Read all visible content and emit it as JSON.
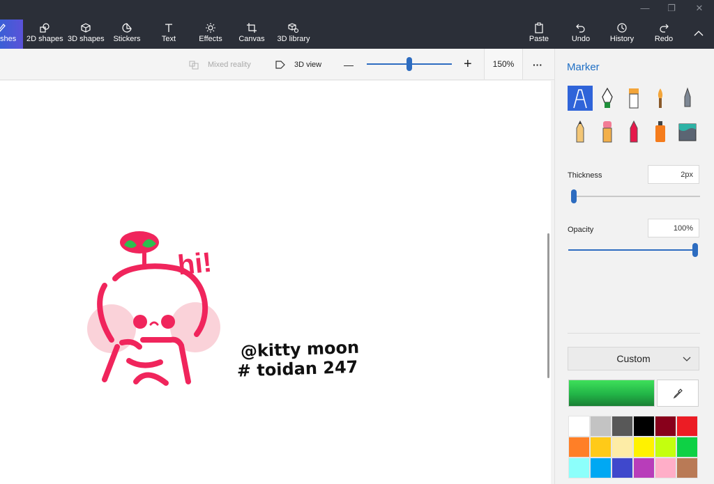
{
  "ribbon": {
    "tools": [
      {
        "label": "Brushes",
        "display": "shes",
        "icon": "brush-icon",
        "active": true
      },
      {
        "label": "2D shapes",
        "icon": "2d-shapes-icon"
      },
      {
        "label": "3D shapes",
        "icon": "3d-shapes-icon"
      },
      {
        "label": "Stickers",
        "icon": "stickers-icon"
      },
      {
        "label": "Text",
        "icon": "text-icon"
      },
      {
        "label": "Effects",
        "icon": "effects-icon"
      },
      {
        "label": "Canvas",
        "icon": "canvas-icon"
      },
      {
        "label": "3D library",
        "icon": "3d-library-icon"
      }
    ],
    "actions": [
      {
        "label": "Paste",
        "icon": "paste-icon"
      },
      {
        "label": "Undo",
        "icon": "undo-icon"
      },
      {
        "label": "History",
        "icon": "history-icon"
      },
      {
        "label": "Redo",
        "icon": "redo-icon"
      }
    ],
    "collapse_icon": "chevron-up-icon",
    "window_controls": {
      "minimize": "—",
      "restore": "❐",
      "close": "✕"
    }
  },
  "command_bar": {
    "mixed_reality": "Mixed reality",
    "view_3d": "3D view",
    "zoom_out": "—",
    "zoom_in": "+",
    "zoom_level": "150%",
    "zoom_fraction": 0.5,
    "more": "···"
  },
  "canvas": {
    "handwriting_line1": "@kitty moon",
    "handwriting_line2": "# toidan 247",
    "bubble_text": "hi!"
  },
  "panel": {
    "title": "Marker",
    "brushes": [
      {
        "name": "marker",
        "selected": true
      },
      {
        "name": "calligraphy-pen"
      },
      {
        "name": "oil-brush"
      },
      {
        "name": "watercolor"
      },
      {
        "name": "pixel-pen"
      },
      {
        "name": "pencil"
      },
      {
        "name": "eraser"
      },
      {
        "name": "crayon"
      },
      {
        "name": "spray-can"
      },
      {
        "name": "fill"
      }
    ],
    "thickness_label": "Thickness",
    "thickness_value": "2px",
    "thickness_fraction": 0.0,
    "opacity_label": "Opacity",
    "opacity_value": "100%",
    "opacity_fraction": 1.0,
    "color_mode": "Custom",
    "current_color": "#22b447",
    "palette": [
      "#ffffff",
      "#c3c3c3",
      "#585858",
      "#000000",
      "#88001b",
      "#ec1c24",
      "#ff7f27",
      "#ffca18",
      "#fdeca6",
      "#fff200",
      "#c4ff0e",
      "#0ed145",
      "#8cfffb",
      "#00a8f3",
      "#3f48cc",
      "#b83dba",
      "#ffaec8",
      "#b97a56"
    ]
  },
  "colors": {
    "ribbon_bg": "#2b2f38",
    "accent": "#2d6cc0",
    "drawing_pink": "#f0255c",
    "cheek_pink": "#f9c7cf",
    "leaf_green": "#2dbf4f"
  }
}
